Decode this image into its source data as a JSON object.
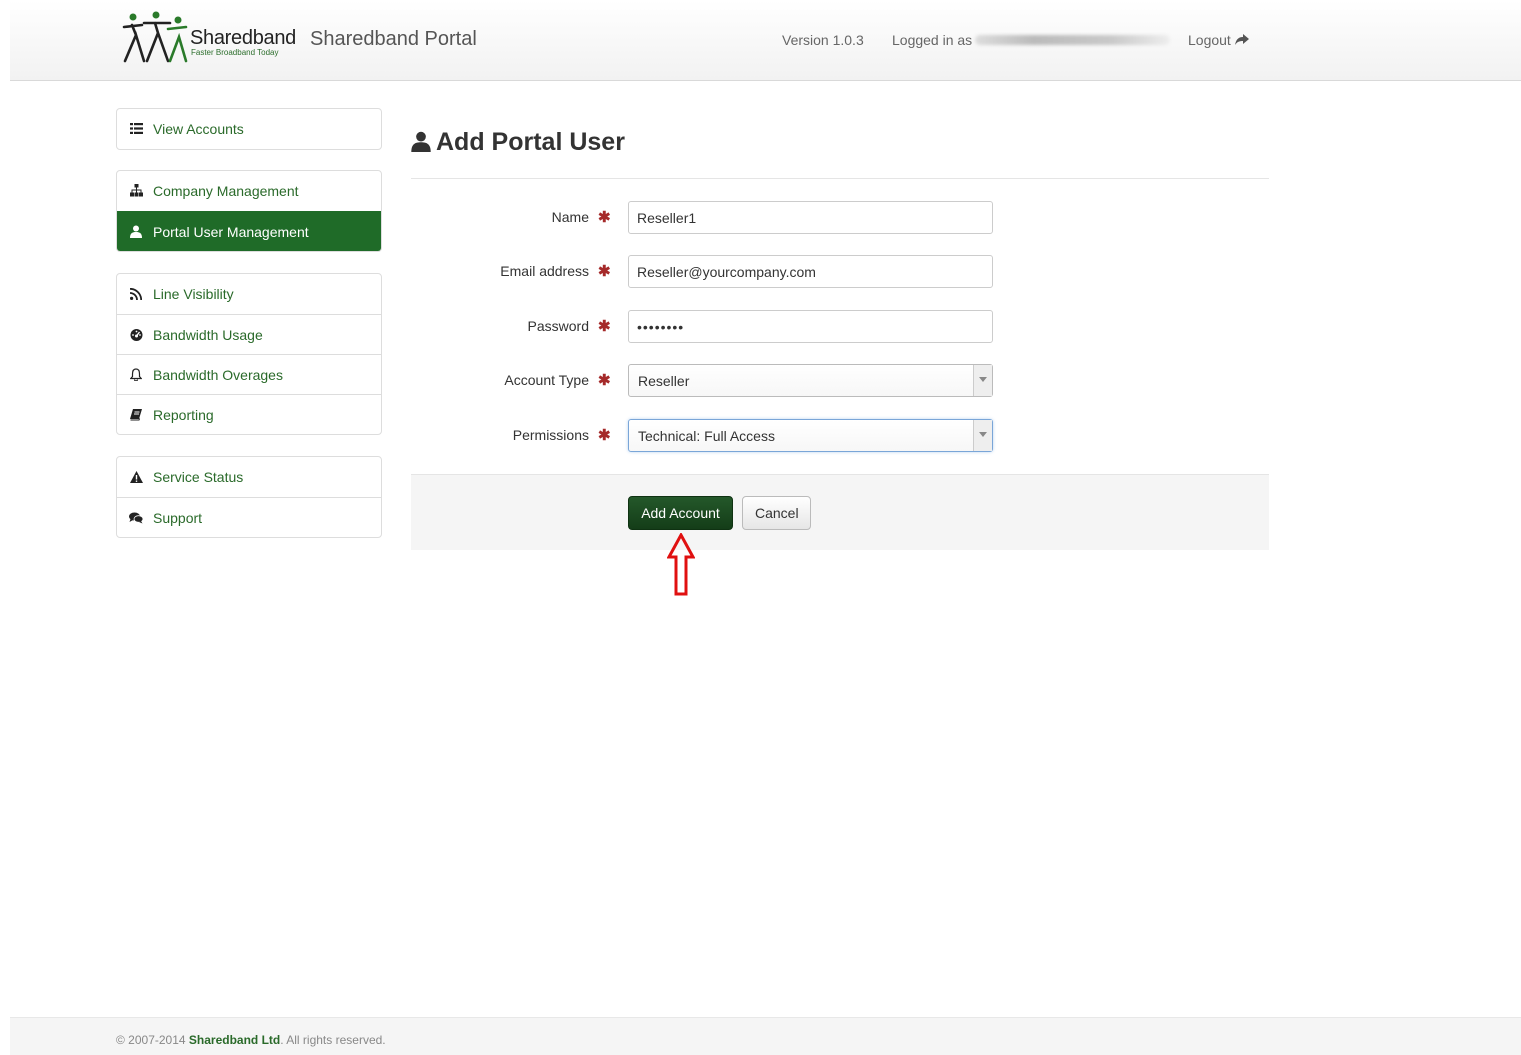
{
  "header": {
    "logo_name": "Sharedband",
    "logo_tagline": "Faster Broadband Today",
    "brand_title": "Sharedband Portal",
    "version": "Version 1.0.3",
    "logged_in_label": "Logged in as",
    "logout_label": "Logout",
    "logout_icon": "share-arrow-icon"
  },
  "sidebar": {
    "groups": [
      [
        {
          "label": "View Accounts",
          "icon": "list-icon"
        }
      ],
      [
        {
          "label": "Company Management",
          "icon": "sitemap-icon"
        },
        {
          "label": "Portal User Management",
          "icon": "user-icon",
          "active": true
        }
      ],
      [
        {
          "label": "Line Visibility",
          "icon": "rss-icon"
        },
        {
          "label": "Bandwidth Usage",
          "icon": "dashboard-icon"
        },
        {
          "label": "Bandwidth Overages",
          "icon": "bell-icon"
        },
        {
          "label": "Reporting",
          "icon": "book-icon"
        }
      ],
      [
        {
          "label": "Service Status",
          "icon": "warning-icon"
        },
        {
          "label": "Support",
          "icon": "comments-icon"
        }
      ]
    ]
  },
  "page": {
    "title": "Add Portal User",
    "title_icon": "user-icon"
  },
  "form": {
    "required_marker": "✱",
    "name": {
      "label": "Name",
      "value": "Reseller1"
    },
    "email": {
      "label": "Email address",
      "value": "Reseller@yourcompany.com"
    },
    "password": {
      "label": "Password",
      "value": "••••••••"
    },
    "account_type": {
      "label": "Account Type",
      "value": "Reseller"
    },
    "permissions": {
      "label": "Permissions",
      "value": "Technical: Full Access"
    },
    "submit_label": "Add Account",
    "cancel_label": "Cancel"
  },
  "annotation": {
    "icon": "up-arrow-annotation-icon",
    "color": "#e01010"
  },
  "footer": {
    "copyright": "© 2007-2014",
    "company": "Sharedband Ltd",
    "rights": ". All rights reserved."
  },
  "colors": {
    "accent": "#1f6b28",
    "link": "#2a6a2a",
    "required": "#a52a2a"
  }
}
